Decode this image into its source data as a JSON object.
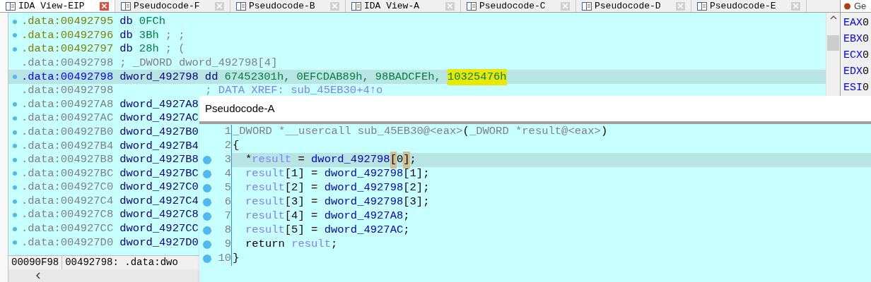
{
  "tabs": [
    {
      "label": "IDA View-EIP",
      "selected": true
    },
    {
      "label": "Pseudocode-F",
      "selected": false
    },
    {
      "label": "Pseudocode-B",
      "selected": false
    },
    {
      "label": "IDA View-A",
      "selected": false
    },
    {
      "label": "Pseudocode-C",
      "selected": false
    },
    {
      "label": "Pseudocode-D",
      "selected": false
    },
    {
      "label": "Pseudocode-E",
      "selected": false
    }
  ],
  "ida_view": {
    "lines": [
      {
        "address": ".data:00492795",
        "kind": "data",
        "marker": true,
        "selected": false,
        "parts": [
          {
            "text": "db",
            "kind": "mnem"
          },
          {
            "text": "0FCh",
            "kind": "num"
          }
        ]
      },
      {
        "address": ".data:00492796",
        "kind": "data",
        "marker": true,
        "selected": false,
        "parts": [
          {
            "text": "db",
            "kind": "mnem"
          },
          {
            "text": "3Bh",
            "kind": "num"
          },
          {
            "text": "; ;",
            "kind": "comment"
          }
        ]
      },
      {
        "address": ".data:00492797",
        "kind": "data",
        "marker": true,
        "selected": false,
        "parts": [
          {
            "text": "db",
            "kind": "mnem"
          },
          {
            "text": "28h",
            "kind": "num"
          },
          {
            "text": "; (",
            "kind": "comment"
          }
        ]
      },
      {
        "address": ".data:00492798",
        "kind": "plain",
        "marker": false,
        "selected": false,
        "parts": [
          {
            "text": "; _DWORD dword_492798[4]",
            "kind": "comment"
          }
        ]
      },
      {
        "address": ".data:00492798",
        "kind": "current",
        "marker": true,
        "selected": true,
        "parts": [
          {
            "text": "dword_492798",
            "kind": "name"
          },
          {
            "text": "dd",
            "kind": "mnem"
          },
          {
            "text": "67452301h,",
            "kind": "num"
          },
          {
            "text": "0EFCDAB89h,",
            "kind": "num"
          },
          {
            "text": "98BADCFEh,",
            "kind": "num"
          },
          {
            "text": "10325476h",
            "kind": "highlight"
          }
        ]
      },
      {
        "address": ".data:00492798",
        "kind": "plain",
        "marker": false,
        "selected": false,
        "parts": [
          {
            "text": "; DATA XREF: sub_45EB30+4↑o",
            "kind": "xref"
          }
        ]
      },
      {
        "address": ".data:004927A8",
        "kind": "plain",
        "marker": true,
        "selected": false,
        "parts": [
          {
            "text": "dword_4927A8",
            "kind": "name"
          }
        ]
      },
      {
        "address": ".data:004927AC",
        "kind": "plain",
        "marker": true,
        "selected": false,
        "parts": [
          {
            "text": "dword_4927AC",
            "kind": "name"
          }
        ]
      },
      {
        "address": ".data:004927B0",
        "kind": "plain",
        "marker": true,
        "selected": false,
        "parts": [
          {
            "text": "dword_4927B0",
            "kind": "name"
          }
        ]
      },
      {
        "address": ".data:004927B4",
        "kind": "plain",
        "marker": true,
        "selected": false,
        "parts": [
          {
            "text": "dword_4927B4",
            "kind": "name"
          }
        ]
      },
      {
        "address": ".data:004927B8",
        "kind": "plain",
        "marker": true,
        "selected": false,
        "parts": [
          {
            "text": "dword_4927B8",
            "kind": "name"
          }
        ]
      },
      {
        "address": ".data:004927BC",
        "kind": "plain",
        "marker": true,
        "selected": false,
        "parts": [
          {
            "text": "dword_4927BC",
            "kind": "name"
          }
        ]
      },
      {
        "address": ".data:004927C0",
        "kind": "plain",
        "marker": true,
        "selected": false,
        "parts": [
          {
            "text": "dword_4927C0",
            "kind": "name"
          }
        ]
      },
      {
        "address": ".data:004927C4",
        "kind": "plain",
        "marker": true,
        "selected": false,
        "parts": [
          {
            "text": "dword_4927C4",
            "kind": "name"
          }
        ]
      },
      {
        "address": ".data:004927C8",
        "kind": "plain",
        "marker": true,
        "selected": false,
        "parts": [
          {
            "text": "dword_4927C8",
            "kind": "name"
          }
        ]
      },
      {
        "address": ".data:004927CC",
        "kind": "plain",
        "marker": true,
        "selected": false,
        "parts": [
          {
            "text": "dword_4927CC",
            "kind": "name"
          }
        ]
      },
      {
        "address": ".data:004927D0",
        "kind": "plain",
        "marker": true,
        "selected": false,
        "parts": [
          {
            "text": "dword_4927D0",
            "kind": "name"
          }
        ]
      }
    ],
    "status_bar": {
      "offset": "00090F98",
      "location": "00492798: .data:dwo"
    }
  },
  "registers": {
    "title": "Ge",
    "rows": [
      {
        "name": "EAX",
        "value": "0"
      },
      {
        "name": "EBX",
        "value": "0"
      },
      {
        "name": "ECX",
        "value": "0"
      },
      {
        "name": "EDX",
        "value": "0"
      },
      {
        "name": "ESI",
        "value": "0"
      }
    ]
  },
  "pseudocode_window": {
    "title": "Pseudocode-A",
    "lines": [
      {
        "number": "1",
        "marker": false,
        "selected": false,
        "indented": false,
        "tokens": [
          {
            "text": "_DWORD *__usercall sub_45EB30@<eax>",
            "kind": "decl"
          },
          {
            "text": "(",
            "kind": "plain"
          },
          {
            "text": "_DWORD *result@<eax>",
            "kind": "decl"
          },
          {
            "text": ")",
            "kind": "plain"
          }
        ]
      },
      {
        "number": "2",
        "marker": false,
        "selected": false,
        "indented": false,
        "tokens": [
          {
            "text": "{",
            "kind": "plain"
          }
        ]
      },
      {
        "number": "3",
        "marker": true,
        "selected": true,
        "indented": true,
        "tokens": [
          {
            "text": "*",
            "kind": "plain"
          },
          {
            "text": "result",
            "kind": "var"
          },
          {
            "text": " = ",
            "kind": "plain"
          },
          {
            "text": "dword_492798",
            "kind": "global"
          },
          {
            "text": "[",
            "kind": "match"
          },
          {
            "text": "0",
            "kind": "plain"
          },
          {
            "text": "]",
            "kind": "match"
          },
          {
            "text": ";",
            "kind": "plain"
          }
        ]
      },
      {
        "number": "4",
        "marker": true,
        "selected": false,
        "indented": true,
        "tokens": [
          {
            "text": "result",
            "kind": "var"
          },
          {
            "text": "[1] = ",
            "kind": "plain"
          },
          {
            "text": "dword_492798",
            "kind": "global"
          },
          {
            "text": "[1];",
            "kind": "plain"
          }
        ]
      },
      {
        "number": "5",
        "marker": true,
        "selected": false,
        "indented": true,
        "tokens": [
          {
            "text": "result",
            "kind": "var"
          },
          {
            "text": "[2] = ",
            "kind": "plain"
          },
          {
            "text": "dword_492798",
            "kind": "global"
          },
          {
            "text": "[2];",
            "kind": "plain"
          }
        ]
      },
      {
        "number": "6",
        "marker": true,
        "selected": false,
        "indented": true,
        "tokens": [
          {
            "text": "result",
            "kind": "var"
          },
          {
            "text": "[3] = ",
            "kind": "plain"
          },
          {
            "text": "dword_492798",
            "kind": "global"
          },
          {
            "text": "[3];",
            "kind": "plain"
          }
        ]
      },
      {
        "number": "7",
        "marker": true,
        "selected": false,
        "indented": true,
        "tokens": [
          {
            "text": "result",
            "kind": "var"
          },
          {
            "text": "[4] = ",
            "kind": "plain"
          },
          {
            "text": "dword_4927A8",
            "kind": "global"
          },
          {
            "text": ";",
            "kind": "plain"
          }
        ]
      },
      {
        "number": "8",
        "marker": true,
        "selected": false,
        "indented": true,
        "tokens": [
          {
            "text": "result",
            "kind": "var"
          },
          {
            "text": "[5] = ",
            "kind": "plain"
          },
          {
            "text": "dword_4927AC",
            "kind": "global"
          },
          {
            "text": ";",
            "kind": "plain"
          }
        ]
      },
      {
        "number": "9",
        "marker": true,
        "selected": false,
        "indented": true,
        "tokens": [
          {
            "text": "return ",
            "kind": "plain"
          },
          {
            "text": "result",
            "kind": "var"
          },
          {
            "text": ";",
            "kind": "plain"
          }
        ]
      },
      {
        "number": "10",
        "marker": true,
        "selected": false,
        "indented": false,
        "tokens": [
          {
            "text": "}",
            "kind": "plain"
          }
        ]
      }
    ]
  }
}
